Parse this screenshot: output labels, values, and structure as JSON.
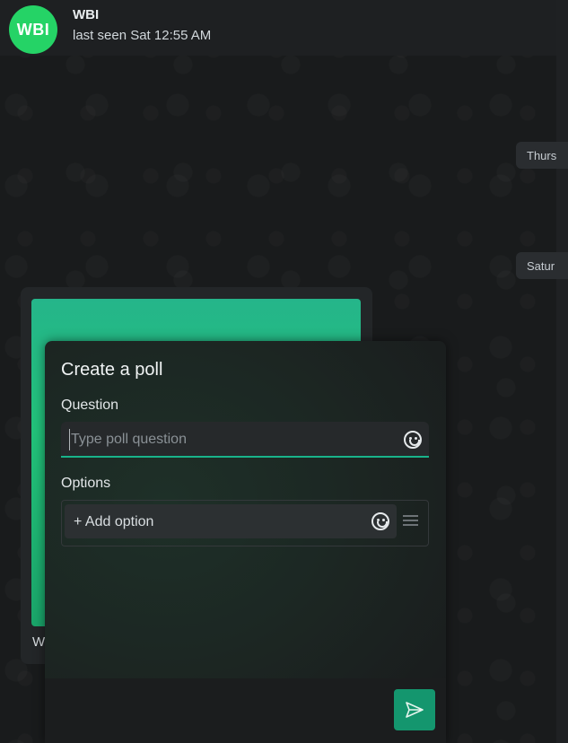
{
  "header": {
    "avatar_text": "WBI",
    "contact_name": "WBI",
    "status": "last seen Sat 12:55 AM"
  },
  "chat": {
    "date_chips": [
      "Thurs",
      "Satur"
    ],
    "message_caption": "W"
  },
  "poll": {
    "title": "Create a poll",
    "question_label": "Question",
    "question_placeholder": "Type poll question",
    "options_label": "Options",
    "add_option_placeholder": "+ Add option",
    "send_icon": "send-icon",
    "emoji_icon": "smiley-icon",
    "drag_icon": "drag-handle-icon"
  },
  "colors": {
    "accent": "#25d366",
    "send_button": "#14966e",
    "input_underline": "#19b38a"
  }
}
